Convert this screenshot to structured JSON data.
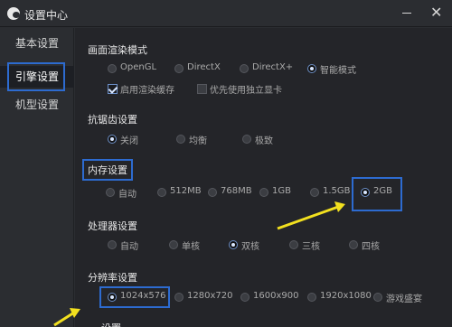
{
  "window": {
    "title": "设置中心",
    "minimize_label": "",
    "close_label": "✕"
  },
  "sidebar": {
    "items": [
      {
        "label": "基本设置"
      },
      {
        "label": "引擎设置"
      },
      {
        "label": "机型设置"
      }
    ]
  },
  "sections": {
    "render": {
      "title": "画面渲染模式",
      "options": [
        "OpenGL",
        "DirectX",
        "DirectX+",
        "智能模式"
      ],
      "selected": "智能模式",
      "checkboxes": [
        {
          "label": "启用渲染缓存",
          "checked": true
        },
        {
          "label": "优先使用独立显卡",
          "checked": false
        }
      ]
    },
    "aa": {
      "title": "抗锯齿设置",
      "options": [
        "关闭",
        "均衡",
        "极致"
      ],
      "selected": "关闭"
    },
    "memory": {
      "title": "内存设置",
      "options": [
        "自动",
        "512MB",
        "768MB",
        "1GB",
        "1.5GB",
        "2GB"
      ],
      "selected": "2GB"
    },
    "cpu": {
      "title": "处理器设置",
      "options": [
        "自动",
        "单核",
        "双核",
        "三核",
        "四核"
      ],
      "selected": "双核"
    },
    "resolution": {
      "title": "分辨率设置",
      "options": [
        "1024x576",
        "1280x720",
        "1600x900",
        "1920x1080",
        "游戏盛宴"
      ],
      "selected": "1024x576"
    },
    "partial": {
      "title": "设置"
    }
  },
  "colors": {
    "highlight": "#2d6bd0",
    "arrow": "#f2e01f"
  }
}
